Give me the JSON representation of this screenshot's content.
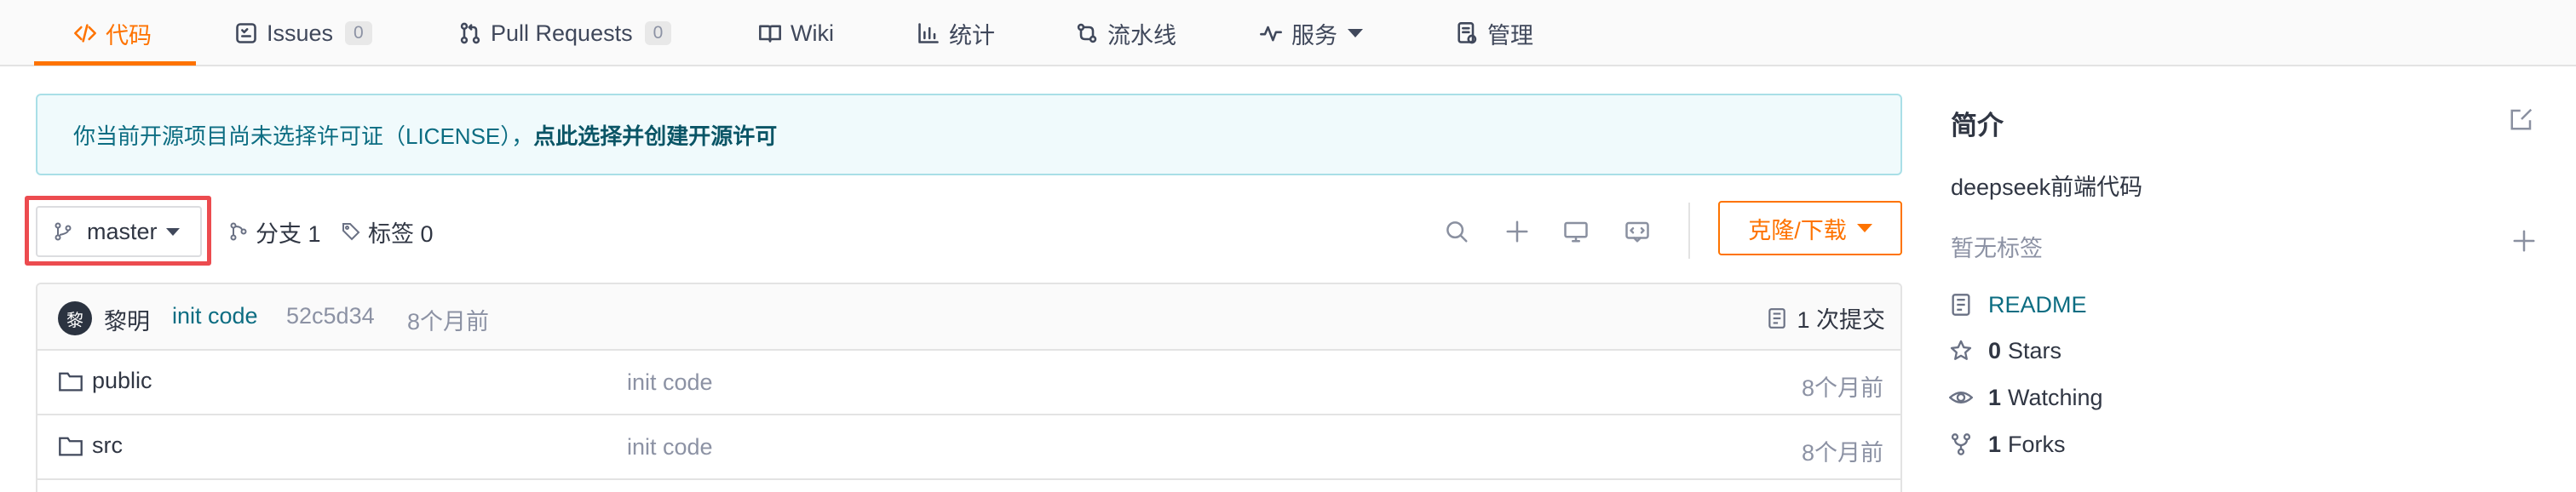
{
  "nav": {
    "tabs": [
      {
        "label": "代码",
        "icon": "code-icon",
        "active": true
      },
      {
        "label": "Issues",
        "icon": "issues-icon",
        "count": "0"
      },
      {
        "label": "Pull Requests",
        "icon": "pull-request-icon",
        "count": "0"
      },
      {
        "label": "Wiki",
        "icon": "wiki-book-icon"
      },
      {
        "label": "统计",
        "icon": "stats-chart-icon"
      },
      {
        "label": "流水线",
        "icon": "pipeline-icon"
      },
      {
        "label": "服务",
        "icon": "service-pulse-icon",
        "dropdown": true
      },
      {
        "label": "管理",
        "icon": "manage-doc-icon"
      }
    ],
    "accent_color": "#fe7300"
  },
  "banner": {
    "text": "你当前开源项目尚未选择许可证（LICENSE），",
    "link": "点此选择并创建开源许可"
  },
  "toolbar": {
    "branch": "master",
    "branches_label": "分支 1",
    "tags_label": "标签 0",
    "clone_label": "克隆/下载",
    "tools": [
      "search-icon",
      "plus-icon",
      "desktop-icon",
      "web-ide-icon"
    ]
  },
  "commit": {
    "avatar_char": "黎",
    "author": "黎明",
    "message": "init code",
    "sha": "52c5d34",
    "time": "8个月前",
    "count_label": "1 次提交"
  },
  "files": [
    {
      "name": "public",
      "message": "init code",
      "time": "8个月前",
      "type": "folder"
    },
    {
      "name": "src",
      "message": "init code",
      "time": "8个月前",
      "type": "folder"
    }
  ],
  "sidebar": {
    "title": "简介",
    "description": "deepseek前端代码",
    "no_tags": "暂无标签",
    "readme": "README",
    "stars_count": "0",
    "stars_label": "Stars",
    "watching_count": "1",
    "watching_label": "Watching",
    "forks_count": "1",
    "forks_label": "Forks"
  }
}
